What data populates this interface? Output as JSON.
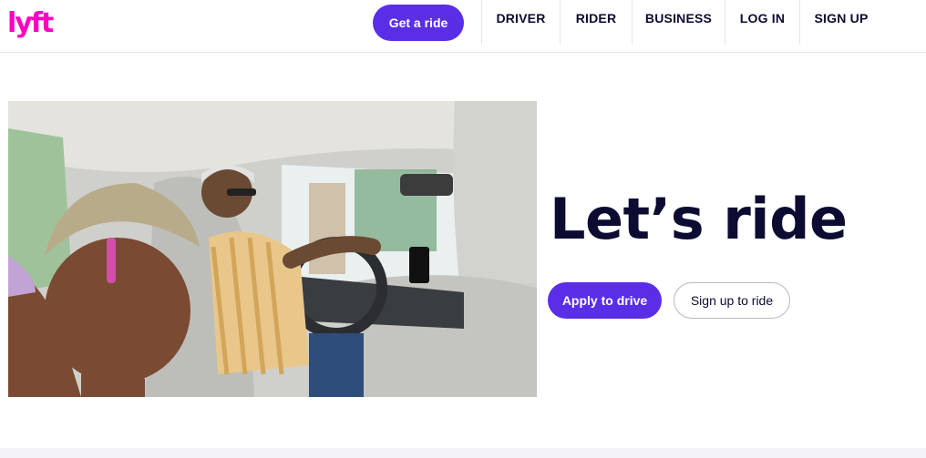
{
  "brand": {
    "name": "lyft",
    "color": "#ff00bf"
  },
  "header": {
    "cta_label": "Get a ride",
    "nav": [
      {
        "label": "DRIVER"
      },
      {
        "label": "RIDER"
      },
      {
        "label": "BUSINESS"
      },
      {
        "label": "LOG IN"
      },
      {
        "label": "SIGN UP"
      }
    ]
  },
  "hero": {
    "headline": "Let’s ride",
    "primary_button": "Apply to drive",
    "secondary_button": "Sign up to ride",
    "image_subject": "passenger-and-driver-laughing-in-car"
  },
  "colors": {
    "accent": "#5a2ee6",
    "text": "#0c0b31",
    "logo": "#ff00bf"
  }
}
